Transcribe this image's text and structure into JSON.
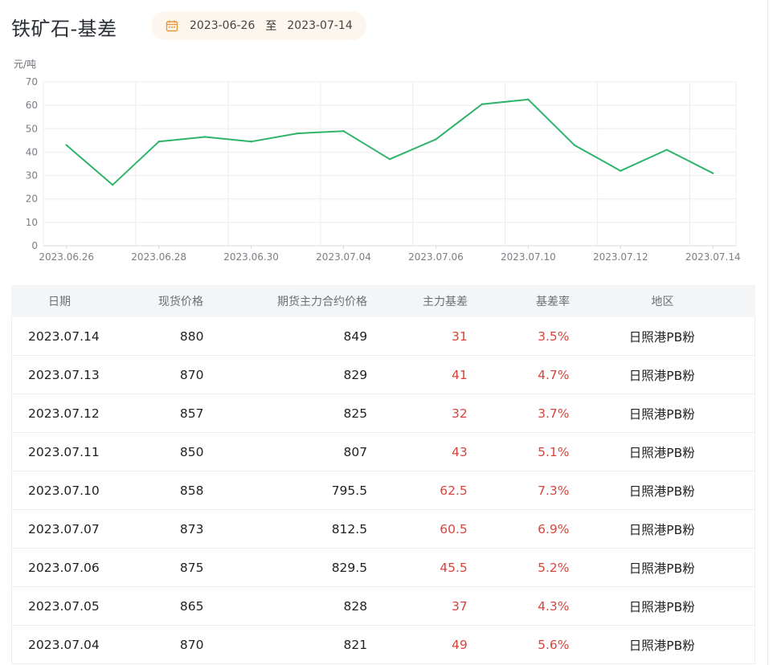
{
  "header": {
    "title": "铁矿石-基差",
    "date_start": "2023-06-26",
    "date_sep": "至",
    "date_end": "2023-07-14",
    "calendar_icon": "calendar-icon"
  },
  "colors": {
    "line": "#2fb36b",
    "accent_red": "#d9443b",
    "pill_bg": "#fdf6ee",
    "calendar_orange": "#e39a3b"
  },
  "chart_data": {
    "type": "line",
    "ylabel": "元/吨",
    "ylim": [
      0,
      70
    ],
    "yticks": [
      "0",
      "10",
      "20",
      "30",
      "40",
      "50",
      "60",
      "70"
    ],
    "xtick_labels": [
      "2023.06.26",
      "2023.06.28",
      "2023.06.30",
      "2023.07.04",
      "2023.07.06",
      "2023.07.10",
      "2023.07.12",
      "2023.07.14"
    ],
    "grid": true,
    "x": [
      "2023.06.26",
      "2023.06.27",
      "2023.06.28",
      "2023.06.29",
      "2023.06.30",
      "2023.07.03",
      "2023.07.04",
      "2023.07.05",
      "2023.07.06",
      "2023.07.07",
      "2023.07.10",
      "2023.07.11",
      "2023.07.12",
      "2023.07.13",
      "2023.07.14"
    ],
    "series": [
      {
        "values": [
          43,
          26,
          44.5,
          46.5,
          44.5,
          48,
          49,
          37,
          45.5,
          60.5,
          62.5,
          43,
          32,
          41,
          31
        ]
      }
    ]
  },
  "table": {
    "headers": [
      "日期",
      "现货价格",
      "期货主力合约价格",
      "主力基差",
      "基差率",
      "地区"
    ],
    "rows": [
      {
        "date": "2023.07.14",
        "spot": "880",
        "futures": "849",
        "basis": "31",
        "rate": "3.5%",
        "region": "日照港PB粉"
      },
      {
        "date": "2023.07.13",
        "spot": "870",
        "futures": "829",
        "basis": "41",
        "rate": "4.7%",
        "region": "日照港PB粉"
      },
      {
        "date": "2023.07.12",
        "spot": "857",
        "futures": "825",
        "basis": "32",
        "rate": "3.7%",
        "region": "日照港PB粉"
      },
      {
        "date": "2023.07.11",
        "spot": "850",
        "futures": "807",
        "basis": "43",
        "rate": "5.1%",
        "region": "日照港PB粉"
      },
      {
        "date": "2023.07.10",
        "spot": "858",
        "futures": "795.5",
        "basis": "62.5",
        "rate": "7.3%",
        "region": "日照港PB粉"
      },
      {
        "date": "2023.07.07",
        "spot": "873",
        "futures": "812.5",
        "basis": "60.5",
        "rate": "6.9%",
        "region": "日照港PB粉"
      },
      {
        "date": "2023.07.06",
        "spot": "875",
        "futures": "829.5",
        "basis": "45.5",
        "rate": "5.2%",
        "region": "日照港PB粉"
      },
      {
        "date": "2023.07.05",
        "spot": "865",
        "futures": "828",
        "basis": "37",
        "rate": "4.3%",
        "region": "日照港PB粉"
      },
      {
        "date": "2023.07.04",
        "spot": "870",
        "futures": "821",
        "basis": "49",
        "rate": "5.6%",
        "region": "日照港PB粉"
      }
    ]
  }
}
